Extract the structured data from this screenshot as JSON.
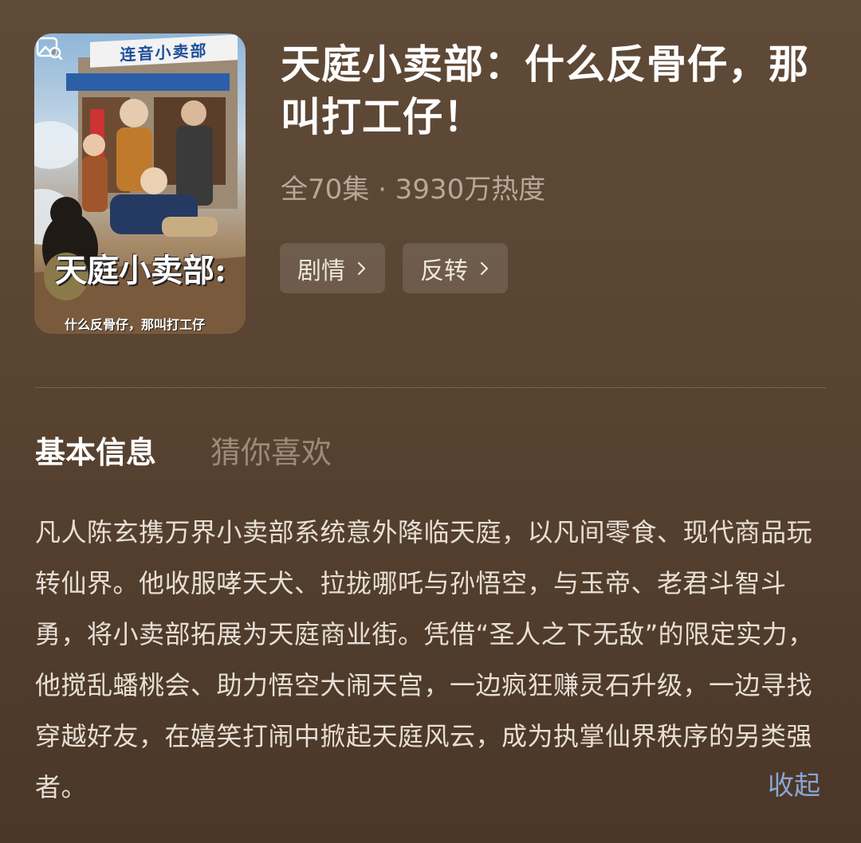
{
  "poster": {
    "sign_text": "连音小卖部",
    "title": "天庭小卖部:",
    "subtitle": "什么反骨仔，那叫打工仔",
    "icon": "image-search-icon"
  },
  "drama": {
    "title": "天庭小卖部：什么反骨仔，那叫打工仔！",
    "meta": "全70集 · 3930万热度",
    "tags": [
      {
        "label": "剧情",
        "icon": "chevron-right-icon"
      },
      {
        "label": "反转",
        "icon": "chevron-right-icon"
      }
    ]
  },
  "tabs": {
    "basic_info": "基本信息",
    "recommend": "猜你喜欢"
  },
  "description": "凡人陈玄携万界小卖部系统意外降临天庭，以凡间零食、现代商品玩转仙界。他收服哮天犬、拉拢哪吒与孙悟空，与玉帝、老君斗智斗勇，将小卖部拓展为天庭商业街。凭借“圣人之下无敌”的限定实力，他搅乱蟠桃会、助力悟空大闹天宫，一边疯狂赚灵石升级，一边寻找穿越好友，在嬉笑打闹中掀起天庭风云，成为执掌仙界秩序的另类强者。",
  "collapse_label": "收起",
  "colors": {
    "background": "#5a4432",
    "accent_link": "#8aa6d4",
    "muted_text": "#b7a898"
  }
}
